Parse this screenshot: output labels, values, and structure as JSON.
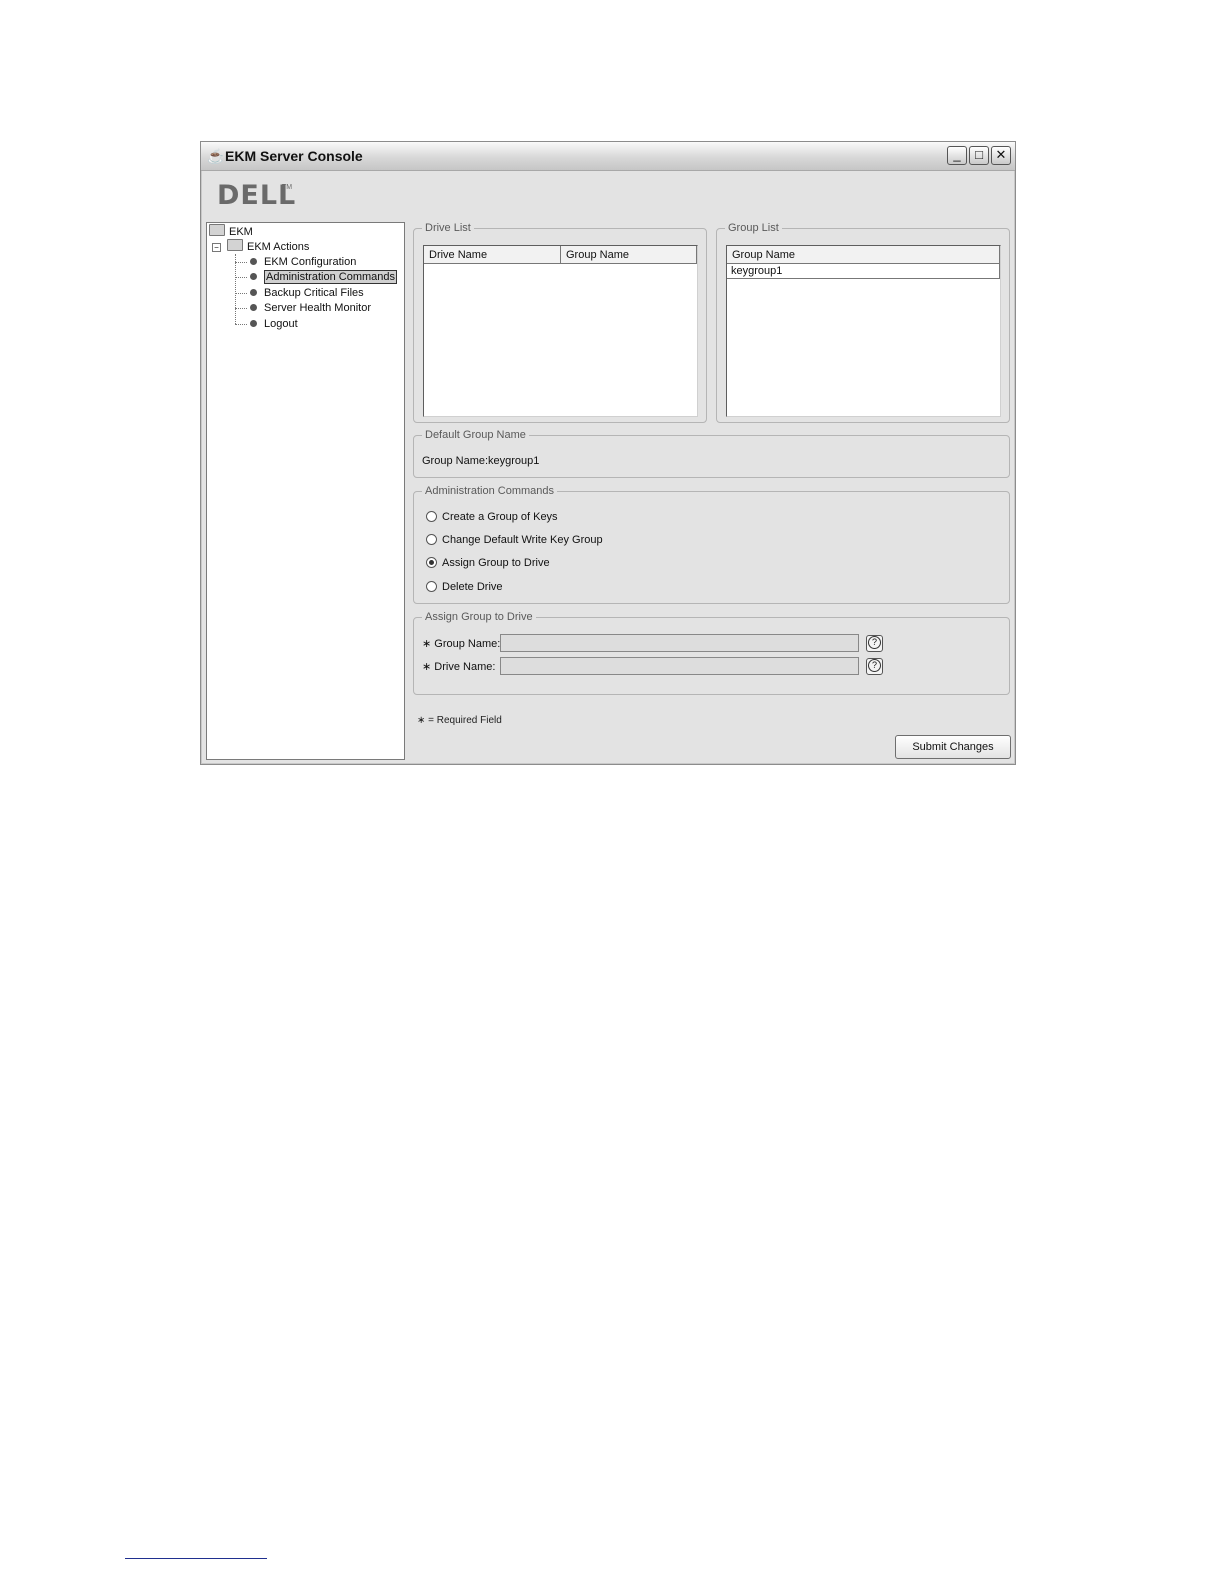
{
  "window": {
    "title": "EKM Server Console",
    "buttons": {
      "minimize": "_",
      "maximize": "□",
      "close": "✕"
    }
  },
  "brand": {
    "logo_text": "DELL",
    "logo_tm": "TM"
  },
  "tree": {
    "root": "EKM",
    "folder": "EKM Actions",
    "expander": "−",
    "items": [
      {
        "label": "EKM Configuration",
        "selected": false
      },
      {
        "label": "Administration Commands",
        "selected": true
      },
      {
        "label": "Backup Critical Files",
        "selected": false
      },
      {
        "label": "Server Health Monitor",
        "selected": false
      },
      {
        "label": "Logout",
        "selected": false
      }
    ]
  },
  "drive_list": {
    "title": "Drive List",
    "columns": [
      "Drive Name",
      "Group Name"
    ],
    "rows": []
  },
  "group_list": {
    "title": "Group List",
    "columns": [
      "Group Name"
    ],
    "rows": [
      "keygroup1"
    ]
  },
  "default_group": {
    "title": "Default Group Name",
    "label": "Group Name:",
    "value": "keygroup1"
  },
  "admin_commands": {
    "title": "Administration Commands",
    "options": [
      {
        "label": "Create a Group of Keys",
        "checked": false
      },
      {
        "label": "Change Default Write Key Group",
        "checked": false
      },
      {
        "label": "Assign Group to Drive",
        "checked": true
      },
      {
        "label": "Delete Drive",
        "checked": false
      }
    ]
  },
  "assign_form": {
    "title": "Assign Group to Drive",
    "required_mark": "∗",
    "fields": [
      {
        "label": "Group Name:",
        "value": ""
      },
      {
        "label": "Drive Name:",
        "value": ""
      }
    ],
    "help": "?"
  },
  "footer": {
    "required_note": "∗ = Required Field",
    "submit_label": "Submit Changes"
  }
}
